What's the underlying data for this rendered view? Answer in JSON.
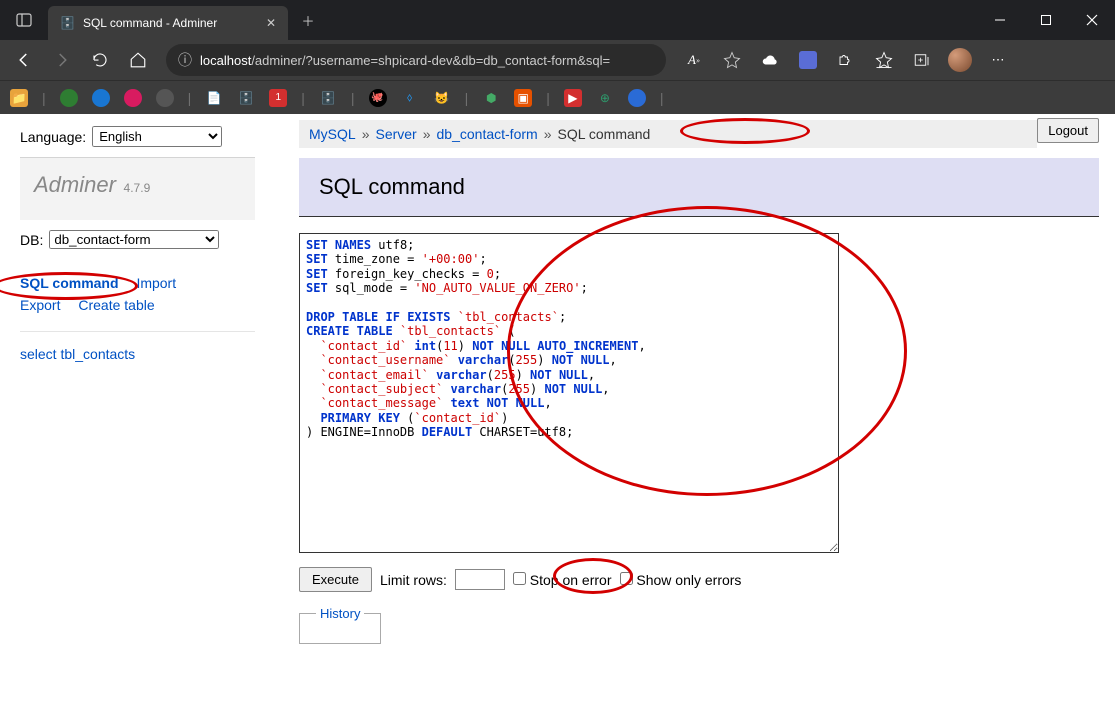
{
  "browser": {
    "tab_title": "SQL command - Adminer",
    "url_prefix": "localhost",
    "url_path": "/adminer/?username=shpicard-dev&db=db_contact-form&sql="
  },
  "sidebar": {
    "language_label": "Language:",
    "language_value": "English",
    "brand": "Adminer",
    "version": "4.7.9",
    "db_label": "DB:",
    "db_value": "db_contact-form",
    "links": {
      "sql_command": "SQL command",
      "import": "Import",
      "export": "Export",
      "create_table": "Create table"
    },
    "table_link": "select tbl_contacts"
  },
  "breadcrumbs": {
    "mysql": "MySQL",
    "server": "Server",
    "db": "db_contact-form",
    "current": "SQL command",
    "logout": "Logout"
  },
  "main": {
    "title": "SQL command",
    "sql": "SET NAMES utf8;\nSET time_zone = '+00:00';\nSET foreign_key_checks = 0;\nSET sql_mode = 'NO_AUTO_VALUE_ON_ZERO';\n\nDROP TABLE IF EXISTS `tbl_contacts`;\nCREATE TABLE `tbl_contacts` (\n  `contact_id` int(11) NOT NULL AUTO_INCREMENT,\n  `contact_username` varchar(255) NOT NULL,\n  `contact_email` varchar(255) NOT NULL,\n  `contact_subject` varchar(255) NOT NULL,\n  `contact_message` text NOT NULL,\n  PRIMARY KEY (`contact_id`)\n) ENGINE=InnoDB DEFAULT CHARSET=utf8;",
    "execute": "Execute",
    "limit_label": "Limit rows:",
    "limit_value": "",
    "stop_on_error": "Stop on error",
    "show_only_errors": "Show only errors",
    "history": "History"
  }
}
